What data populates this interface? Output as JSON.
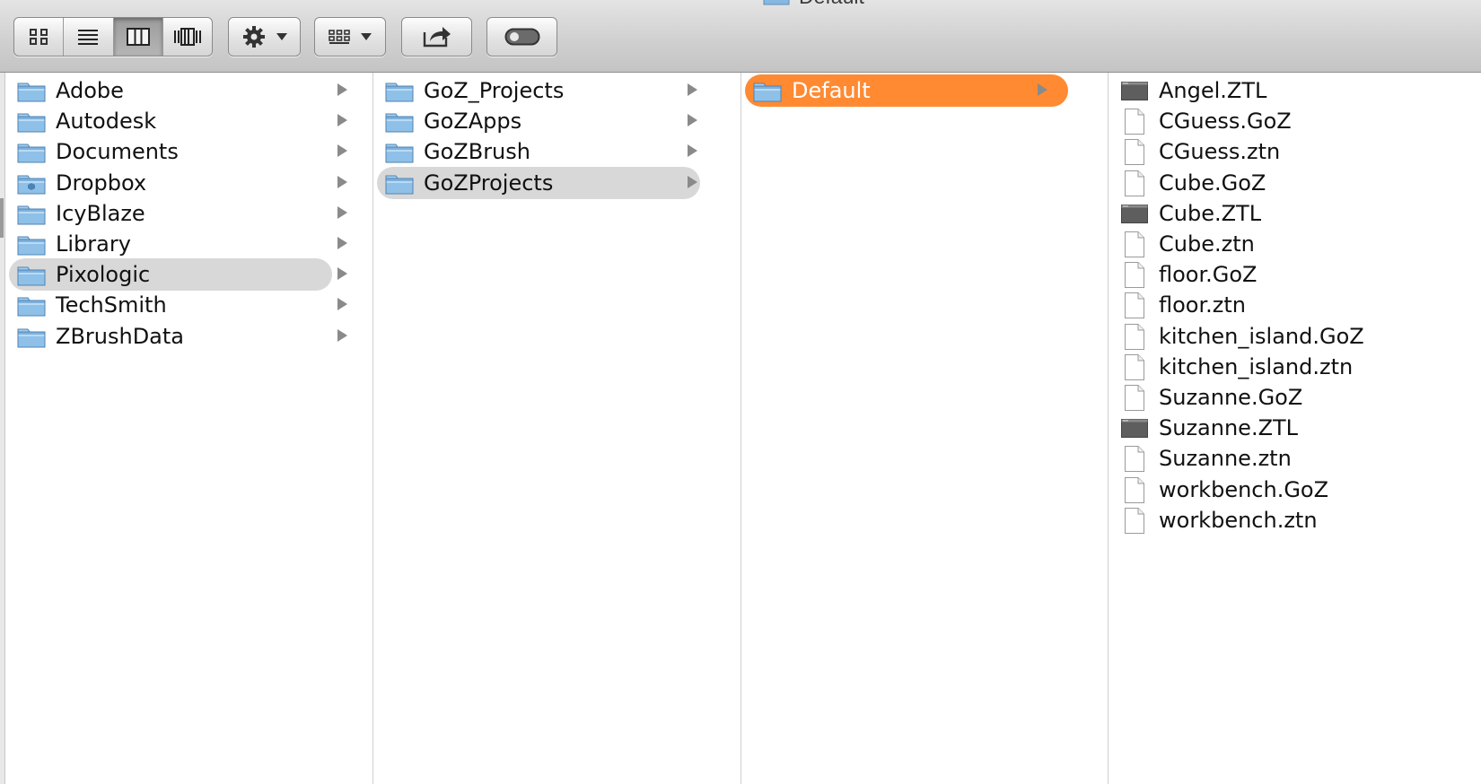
{
  "window": {
    "title": "Default"
  },
  "toolbar": {
    "view_buttons": [
      {
        "name": "icon-view-button",
        "icon": "icon-view-icon",
        "active": false
      },
      {
        "name": "list-view-button",
        "icon": "list-view-icon",
        "active": false
      },
      {
        "name": "column-view-button",
        "icon": "column-view-icon",
        "active": true
      },
      {
        "name": "cover-flow-button",
        "icon": "cover-flow-icon",
        "active": false
      }
    ],
    "action_icon": "gear-icon",
    "arrange_icon": "arrange-grid-icon",
    "share_icon": "share-icon",
    "toggle_icon": "toolbar-toggle-icon"
  },
  "colors": {
    "selected_active": "#ff8a32",
    "selected_inactive": "#d8d8d8",
    "folder_blue": "#7fb2dd"
  },
  "columns": [
    {
      "items": [
        {
          "label": "Adobe",
          "icon": "folder-icon",
          "has_children": true,
          "selected": false
        },
        {
          "label": "Autodesk",
          "icon": "folder-icon",
          "has_children": true,
          "selected": false
        },
        {
          "label": "Documents",
          "icon": "folder-icon",
          "has_children": true,
          "selected": false
        },
        {
          "label": "Dropbox",
          "icon": "dropbox-folder-icon",
          "has_children": true,
          "selected": false
        },
        {
          "label": "IcyBlaze",
          "icon": "folder-icon",
          "has_children": true,
          "selected": false
        },
        {
          "label": "Library",
          "icon": "folder-icon",
          "has_children": true,
          "selected": false
        },
        {
          "label": "Pixologic",
          "icon": "folder-icon",
          "has_children": true,
          "selected": "inactive"
        },
        {
          "label": "TechSmith",
          "icon": "folder-icon",
          "has_children": true,
          "selected": false
        },
        {
          "label": "ZBrushData",
          "icon": "folder-icon",
          "has_children": true,
          "selected": false
        }
      ]
    },
    {
      "items": [
        {
          "label": "GoZ_Projects",
          "icon": "folder-icon",
          "has_children": true,
          "selected": false
        },
        {
          "label": "GoZApps",
          "icon": "folder-icon",
          "has_children": true,
          "selected": false
        },
        {
          "label": "GoZBrush",
          "icon": "folder-icon",
          "has_children": true,
          "selected": false
        },
        {
          "label": "GoZProjects",
          "icon": "folder-icon",
          "has_children": true,
          "selected": "inactive"
        }
      ]
    },
    {
      "items": [
        {
          "label": "Default",
          "icon": "folder-icon",
          "has_children": true,
          "selected": "active"
        }
      ]
    },
    {
      "items": [
        {
          "label": "Angel.ZTL",
          "icon": "ztl-file-icon"
        },
        {
          "label": "CGuess.GoZ",
          "icon": "document-icon"
        },
        {
          "label": "CGuess.ztn",
          "icon": "document-icon"
        },
        {
          "label": "Cube.GoZ",
          "icon": "document-icon"
        },
        {
          "label": "Cube.ZTL",
          "icon": "ztl-file-icon"
        },
        {
          "label": "Cube.ztn",
          "icon": "document-icon"
        },
        {
          "label": "floor.GoZ",
          "icon": "document-icon"
        },
        {
          "label": "floor.ztn",
          "icon": "document-icon"
        },
        {
          "label": "kitchen_island.GoZ",
          "icon": "document-icon"
        },
        {
          "label": "kitchen_island.ztn",
          "icon": "document-icon"
        },
        {
          "label": "Suzanne.GoZ",
          "icon": "document-icon"
        },
        {
          "label": "Suzanne.ZTL",
          "icon": "ztl-file-icon"
        },
        {
          "label": "Suzanne.ztn",
          "icon": "document-icon"
        },
        {
          "label": "workbench.GoZ",
          "icon": "document-icon"
        },
        {
          "label": "workbench.ztn",
          "icon": "document-icon"
        }
      ]
    }
  ]
}
